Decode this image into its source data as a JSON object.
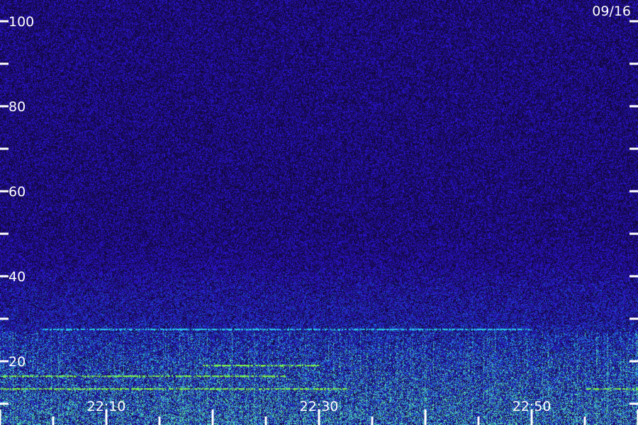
{
  "chart_data": {
    "type": "heatmap",
    "date_label": "09/16",
    "y_ticks": [
      20,
      40,
      60,
      80,
      100
    ],
    "y_range": [
      0,
      100
    ],
    "x_ticks": [
      "22:10",
      "22:30",
      "22:50"
    ],
    "x_range": [
      "22:00",
      "23:00"
    ],
    "grid": false,
    "colors": {
      "background": "#1a0a5c",
      "noise_low": "#2a14b8",
      "noise_mid": "#1f4bd8",
      "band_cyan": "#29c9e8",
      "band_green": "#7cf04a",
      "tick": "#ffffff"
    },
    "bands": [
      {
        "y": 27.5,
        "from": "22:04",
        "to": "22:50",
        "color": "band_cyan"
      },
      {
        "y": 19.0,
        "from": "22:19",
        "to": "22:30",
        "color": "band_green"
      },
      {
        "y": 16.5,
        "from": "22:00",
        "to": "22:27",
        "color": "band_green"
      },
      {
        "y": 13.5,
        "from": "22:00",
        "to": "22:33",
        "color": "band_green"
      },
      {
        "y": 13.5,
        "from": "22:55",
        "to": "23:00",
        "color": "band_green"
      }
    ]
  }
}
